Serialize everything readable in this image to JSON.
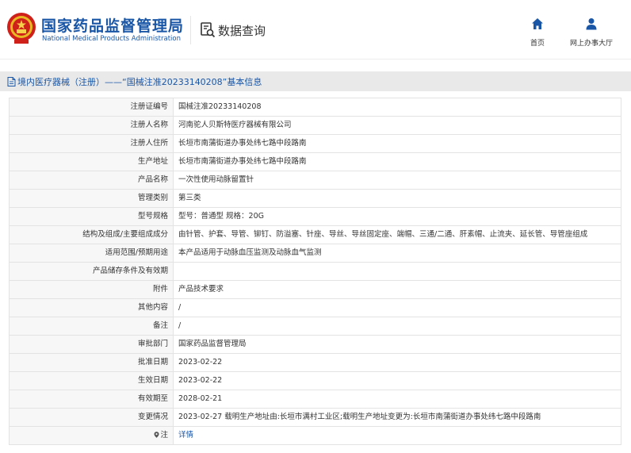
{
  "header": {
    "brand_cn": "国家药品监督管理局",
    "brand_en": "National Medical Products Administration",
    "query_label": "数据查询",
    "nav": [
      {
        "label": "首页",
        "icon": "home-icon"
      },
      {
        "label": "网上办事大厅",
        "icon": "user-icon"
      }
    ]
  },
  "breadcrumb": {
    "text": "境内医疗器械（注册）——“国械注准20233140208”基本信息",
    "icon": "document-icon"
  },
  "colors": {
    "brand_blue": "#1a56a6",
    "key_bg": "#f7f7f7",
    "crumb_bg": "#e9e9ea",
    "border": "#e3e3e3"
  },
  "record": {
    "rows": [
      {
        "key": "注册证编号",
        "value": "国械注准20233140208"
      },
      {
        "key": "注册人名称",
        "value": "河南驼人贝斯特医疗器械有限公司"
      },
      {
        "key": "注册人住所",
        "value": "长垣市南蒲街道办事处纬七路中段路南"
      },
      {
        "key": "生产地址",
        "value": "长垣市南蒲街道办事处纬七路中段路南"
      },
      {
        "key": "产品名称",
        "value": "一次性使用动脉留置针"
      },
      {
        "key": "管理类别",
        "value": "第三类"
      },
      {
        "key": "型号规格",
        "value": "型号：普通型 规格：20G"
      },
      {
        "key": "结构及组成/主要组成成分",
        "value": "由针管、护套、导管、铆钉、防溢塞、针座、导丝、导丝固定座、端帽、三通/二通、肝素帽、止流夹、延长管、导管座组成"
      },
      {
        "key": "适用范围/预期用途",
        "value": "本产品适用于动脉血压监测及动脉血气监测"
      },
      {
        "key": "产品储存条件及有效期",
        "value": ""
      },
      {
        "key": "附件",
        "value": "产品技术要求"
      },
      {
        "key": "其他内容",
        "value": "/"
      },
      {
        "key": "备注",
        "value": "/"
      },
      {
        "key": "审批部门",
        "value": "国家药品监督管理局"
      },
      {
        "key": "批准日期",
        "value": "2023-02-22"
      },
      {
        "key": "生效日期",
        "value": "2023-02-22"
      },
      {
        "key": "有效期至",
        "value": "2028-02-21"
      },
      {
        "key": "变更情况",
        "value": "2023-02-27 载明生产地址由:长垣市满村工业区;载明生产地址变更为:长垣市南蒲街道办事处纬七路中段路南"
      },
      {
        "key": "注",
        "value": "详情",
        "key_icon": "pin-icon",
        "link": true
      }
    ]
  }
}
